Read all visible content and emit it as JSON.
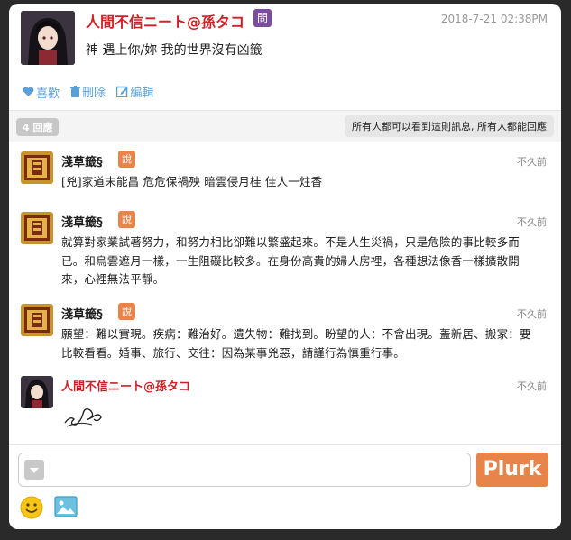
{
  "post": {
    "author": "人間不信ニート@孫タコ",
    "qualifier": "問",
    "timestamp": "2018-7-21 02:38PM",
    "text": "神 遇上你/妳 我的世界沒有凶籤"
  },
  "actions": {
    "like": "喜歡",
    "delete": "刪除",
    "edit": "編輯"
  },
  "response_bar": {
    "count": "4 回應",
    "visibility": "所有人都可以看到這則訊息, 所有人都能回應"
  },
  "responses": [
    {
      "author": "淺草籤§",
      "qualifier": "說",
      "time": "不久前",
      "text": "[兇]家道未能昌 危危保禍殃 暗雲侵月桂 佳人一炷香"
    },
    {
      "author": "淺草籤§",
      "qualifier": "說",
      "time": "不久前",
      "text": "就算對家業試著努力，和努力相比卻難以繁盛起來。不是人生災禍，只是危險的事比較多而已。和烏雲遮月一樣，一生阻礙比較多。在身份高貴的婦人房裡，各種想法像香一樣擴散開來，心裡無法平靜。"
    },
    {
      "author": "淺草籤§",
      "qualifier": "說",
      "time": "不久前",
      "text": "願望：難以實現。疾病：難治好。遺失物：難找到。盼望的人：不會出現。蓋新居、搬家：要比較看看。婚事、旅行、交往：因為某事兇惡，請謹行為慎重行事。"
    },
    {
      "author": "人間不信ニート@孫タコ",
      "time": "不久前"
    }
  ],
  "composer": {
    "placeholder": "",
    "submit_label": "Plurk"
  },
  "colors": {
    "accent_orange": "#e8834a",
    "author_red": "#d02027",
    "link_blue": "#5aa0d8",
    "qualifier_purple": "#7c4d9e"
  }
}
